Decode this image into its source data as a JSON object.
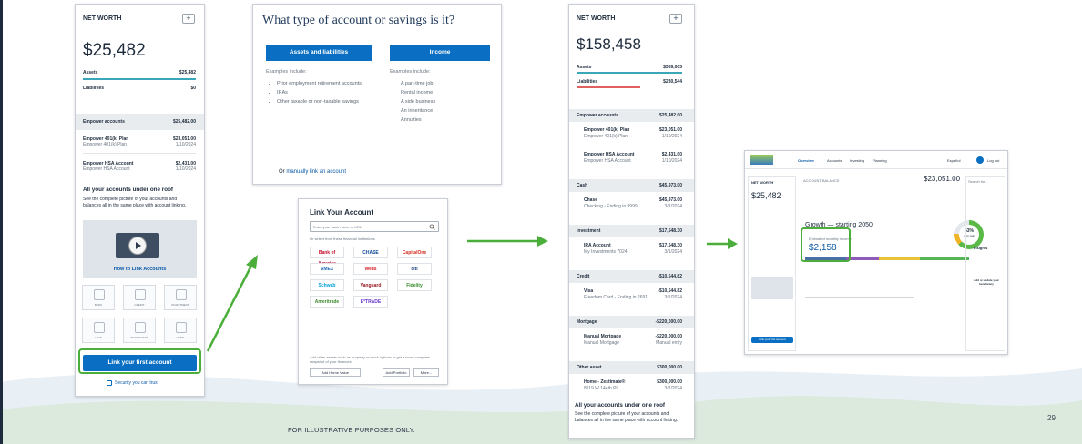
{
  "footer": {
    "disclaimer": "FOR ILLUSTRATIVE PURPOSES ONLY.",
    "page_number": "29"
  },
  "panel1": {
    "title": "NET WORTH",
    "plus": "+",
    "total": "$25,482",
    "assets_label": "Assets",
    "assets_value": "$25,482",
    "liabilities_label": "Liabilities",
    "liabilities_value": "$0",
    "group_label": "Empower accounts",
    "group_value": "$25,482.00",
    "accounts": [
      {
        "name": "Empower 401(k) Plan",
        "sub": "Empower 401(k) Plan",
        "value": "$23,051.00",
        "date": "1/10/2024"
      },
      {
        "name": "Empower HSA Account",
        "sub": "Empower HSA Account",
        "value": "$2,431.00",
        "date": "1/10/2024"
      }
    ],
    "promo_title": "All your accounts under one roof",
    "promo_text": "See the complete picture of your accounts and balances all in the same place with account linking.",
    "video_caption": "How to Link Accounts",
    "tiles": [
      "BANK",
      "CREDIT",
      "INVESTMENT",
      "LOAN",
      "RETIREMENT",
      "HOME"
    ],
    "cta": "Link your first account",
    "security": "Security you can trust"
  },
  "panel2": {
    "question": "What type of account or savings is it?",
    "col1_header": "Assets and liabilities",
    "col1_intro": "Examples include:",
    "col1_items": [
      "Prior employment retirement accounts",
      "IRAs",
      "Other taxable or non-taxable savings"
    ],
    "col2_header": "Income",
    "col2_intro": "Examples include:",
    "col2_items": [
      "A part-time job",
      "Rental income",
      "A side business",
      "An inheritance",
      "Annuities"
    ],
    "manual_prefix": "Or",
    "manual_link": "manually link an account"
  },
  "panel3": {
    "title": "Link Your Account",
    "search_placeholder": "Enter your bank name or URL",
    "select_text": "Or select from these financial institutions",
    "logos": [
      {
        "name": "Bank of America",
        "color": "#c8102e"
      },
      {
        "name": "CHASE",
        "color": "#124a94"
      },
      {
        "name": "CapitalOne",
        "color": "#d22e1e"
      },
      {
        "name": "AMEX",
        "color": "#2671b9"
      },
      {
        "name": "Wells",
        "color": "#d71e28"
      },
      {
        "name": "citi",
        "color": "#1b3e7d"
      },
      {
        "name": "Schwab",
        "color": "#00a0df"
      },
      {
        "name": "Vanguard",
        "color": "#96151d"
      },
      {
        "name": "Fidelity",
        "color": "#388c2c"
      },
      {
        "name": "Ameritrade",
        "color": "#3c8a2f"
      },
      {
        "name": "E*TRADE",
        "color": "#6633cc"
      }
    ],
    "note": "Add other assets such as property or stock options to get a more complete snapshot of your finances.",
    "buttons": [
      "Add Home Value",
      "Add Portfolio",
      "More..."
    ]
  },
  "panel4": {
    "title": "NET WORTH",
    "plus": "+",
    "total": "$158,458",
    "assets_label": "Assets",
    "assets_value": "$389,003",
    "liabilities_label": "Liabilities",
    "liabilities_value": "$230,544",
    "groups": [
      {
        "label": "Empower accounts",
        "value": "$25,482.00",
        "items": [
          {
            "name": "Empower 401(k) Plan",
            "sub": "Empower 401(k) Plan",
            "value": "$23,051.00",
            "date": "1/10/2024"
          },
          {
            "name": "Empower HSA Account",
            "sub": "Empower HSA Account",
            "value": "$2,431.00",
            "date": "1/10/2024"
          }
        ]
      },
      {
        "label": "Cash",
        "value": "$45,973.00",
        "items": [
          {
            "name": "Chase",
            "sub": "Checking - Ending in 9999",
            "value": "$45,973.00",
            "date": "3/1/2024"
          }
        ]
      },
      {
        "label": "Investment",
        "value": "$17,548.30",
        "items": [
          {
            "name": "IRA Account",
            "sub": "My Investments 7024",
            "value": "$17,548.30",
            "date": "3/1/2024"
          }
        ]
      },
      {
        "label": "Credit",
        "value": "-$10,544.82",
        "items": [
          {
            "name": "Visa",
            "sub": "Freedom Card - Ending in 2691",
            "value": "-$10,544.82",
            "date": "3/1/2024"
          }
        ]
      },
      {
        "label": "Mortgage",
        "value": "-$220,000.00",
        "items": [
          {
            "name": "Manual Mortgage",
            "sub": "Manual Mortgage",
            "value": "-$220,000.00",
            "date": "Manual entry"
          }
        ]
      },
      {
        "label": "Other asset",
        "value": "$300,000.00",
        "items": [
          {
            "name": "Home - Zestimate®",
            "sub": "8119 W 144th Pl",
            "value": "$300,000.00",
            "date": "3/1/2024"
          }
        ]
      }
    ],
    "promo_title": "All your accounts under one roof",
    "promo_text": "See the complete picture of your accounts and balances all in the same place with account linking."
  },
  "panel5": {
    "nav": [
      "Overview",
      "Accounts",
      "Investing",
      "Planning"
    ],
    "lang": "Español",
    "logout": "Log out",
    "sidebar_title": "NET WORTH",
    "sidebar_total": "$25,482",
    "balance_label": "ACCOUNT BALANCE",
    "balance": "$23,051.00",
    "headline": "Growth — starting 2050",
    "income_label": "Estimated monthly income",
    "income": "$2,158",
    "percent": "63%",
    "percent_sub": "of my goal",
    "search": "Search for...",
    "insights": "Insights",
    "beneficiary_title": "Add or update your beneficiary",
    "cta": "Link your first account"
  }
}
